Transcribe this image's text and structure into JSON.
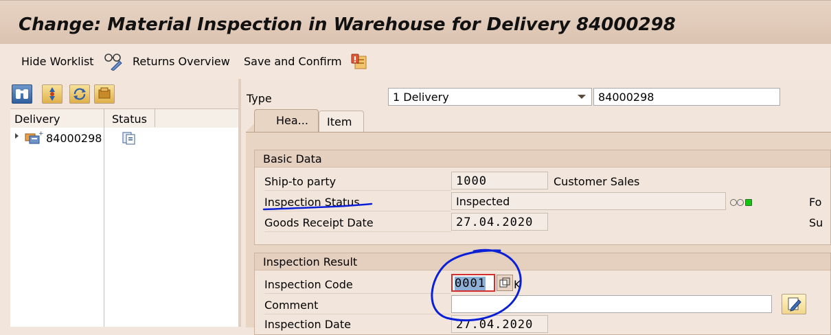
{
  "title": "Change: Material Inspection in Warehouse for Delivery 84000298",
  "toolbar": {
    "hide_worklist": "Hide Worklist",
    "returns_overview": "Returns Overview",
    "save_and_confirm": "Save and Confirm"
  },
  "worklist": {
    "columns": [
      "Delivery",
      "Status"
    ],
    "rows": [
      {
        "delivery": "84000298"
      }
    ]
  },
  "header": {
    "type_label": "Type",
    "type_value": "1 Delivery",
    "doc_number": "84000298"
  },
  "tabs": [
    {
      "label": "Hea..."
    },
    {
      "label": "Item"
    }
  ],
  "basic_data": {
    "title": "Basic Data",
    "ship_to_label": "Ship-to party",
    "ship_to_value": "1000",
    "ship_to_name": "Customer Sales",
    "insp_status_label": "Inspection Status",
    "insp_status_value": "Inspected",
    "gr_date_label": "Goods Receipt Date",
    "gr_date_value": "27.04.2020",
    "cut_right_1": "Fo",
    "cut_right_2": "Su"
  },
  "inspection_result": {
    "title": "Inspection Result",
    "code_label": "Inspection Code",
    "code_value": "0001",
    "code_overflow": "K",
    "comment_label": "Comment",
    "comment_value": "",
    "date_label": "Inspection Date",
    "date_value": "27.04.2020"
  },
  "icons": {
    "toolbar": [
      "glasses-icon",
      "save-confirm-icon"
    ],
    "worklist_buttons": [
      "binoculars-icon",
      "filter-icon",
      "refresh-icon",
      "settings-icon"
    ],
    "tree": [
      "delivery-icon",
      "status-doc-icon"
    ]
  },
  "colors": {
    "title_bar": "#dcc3b1",
    "background": "#f2e6dc",
    "tab_active": "#e9d5c4",
    "annotation": "#0a1fd6",
    "status_green": "#11c511",
    "highlight": "#8fb0d6"
  }
}
